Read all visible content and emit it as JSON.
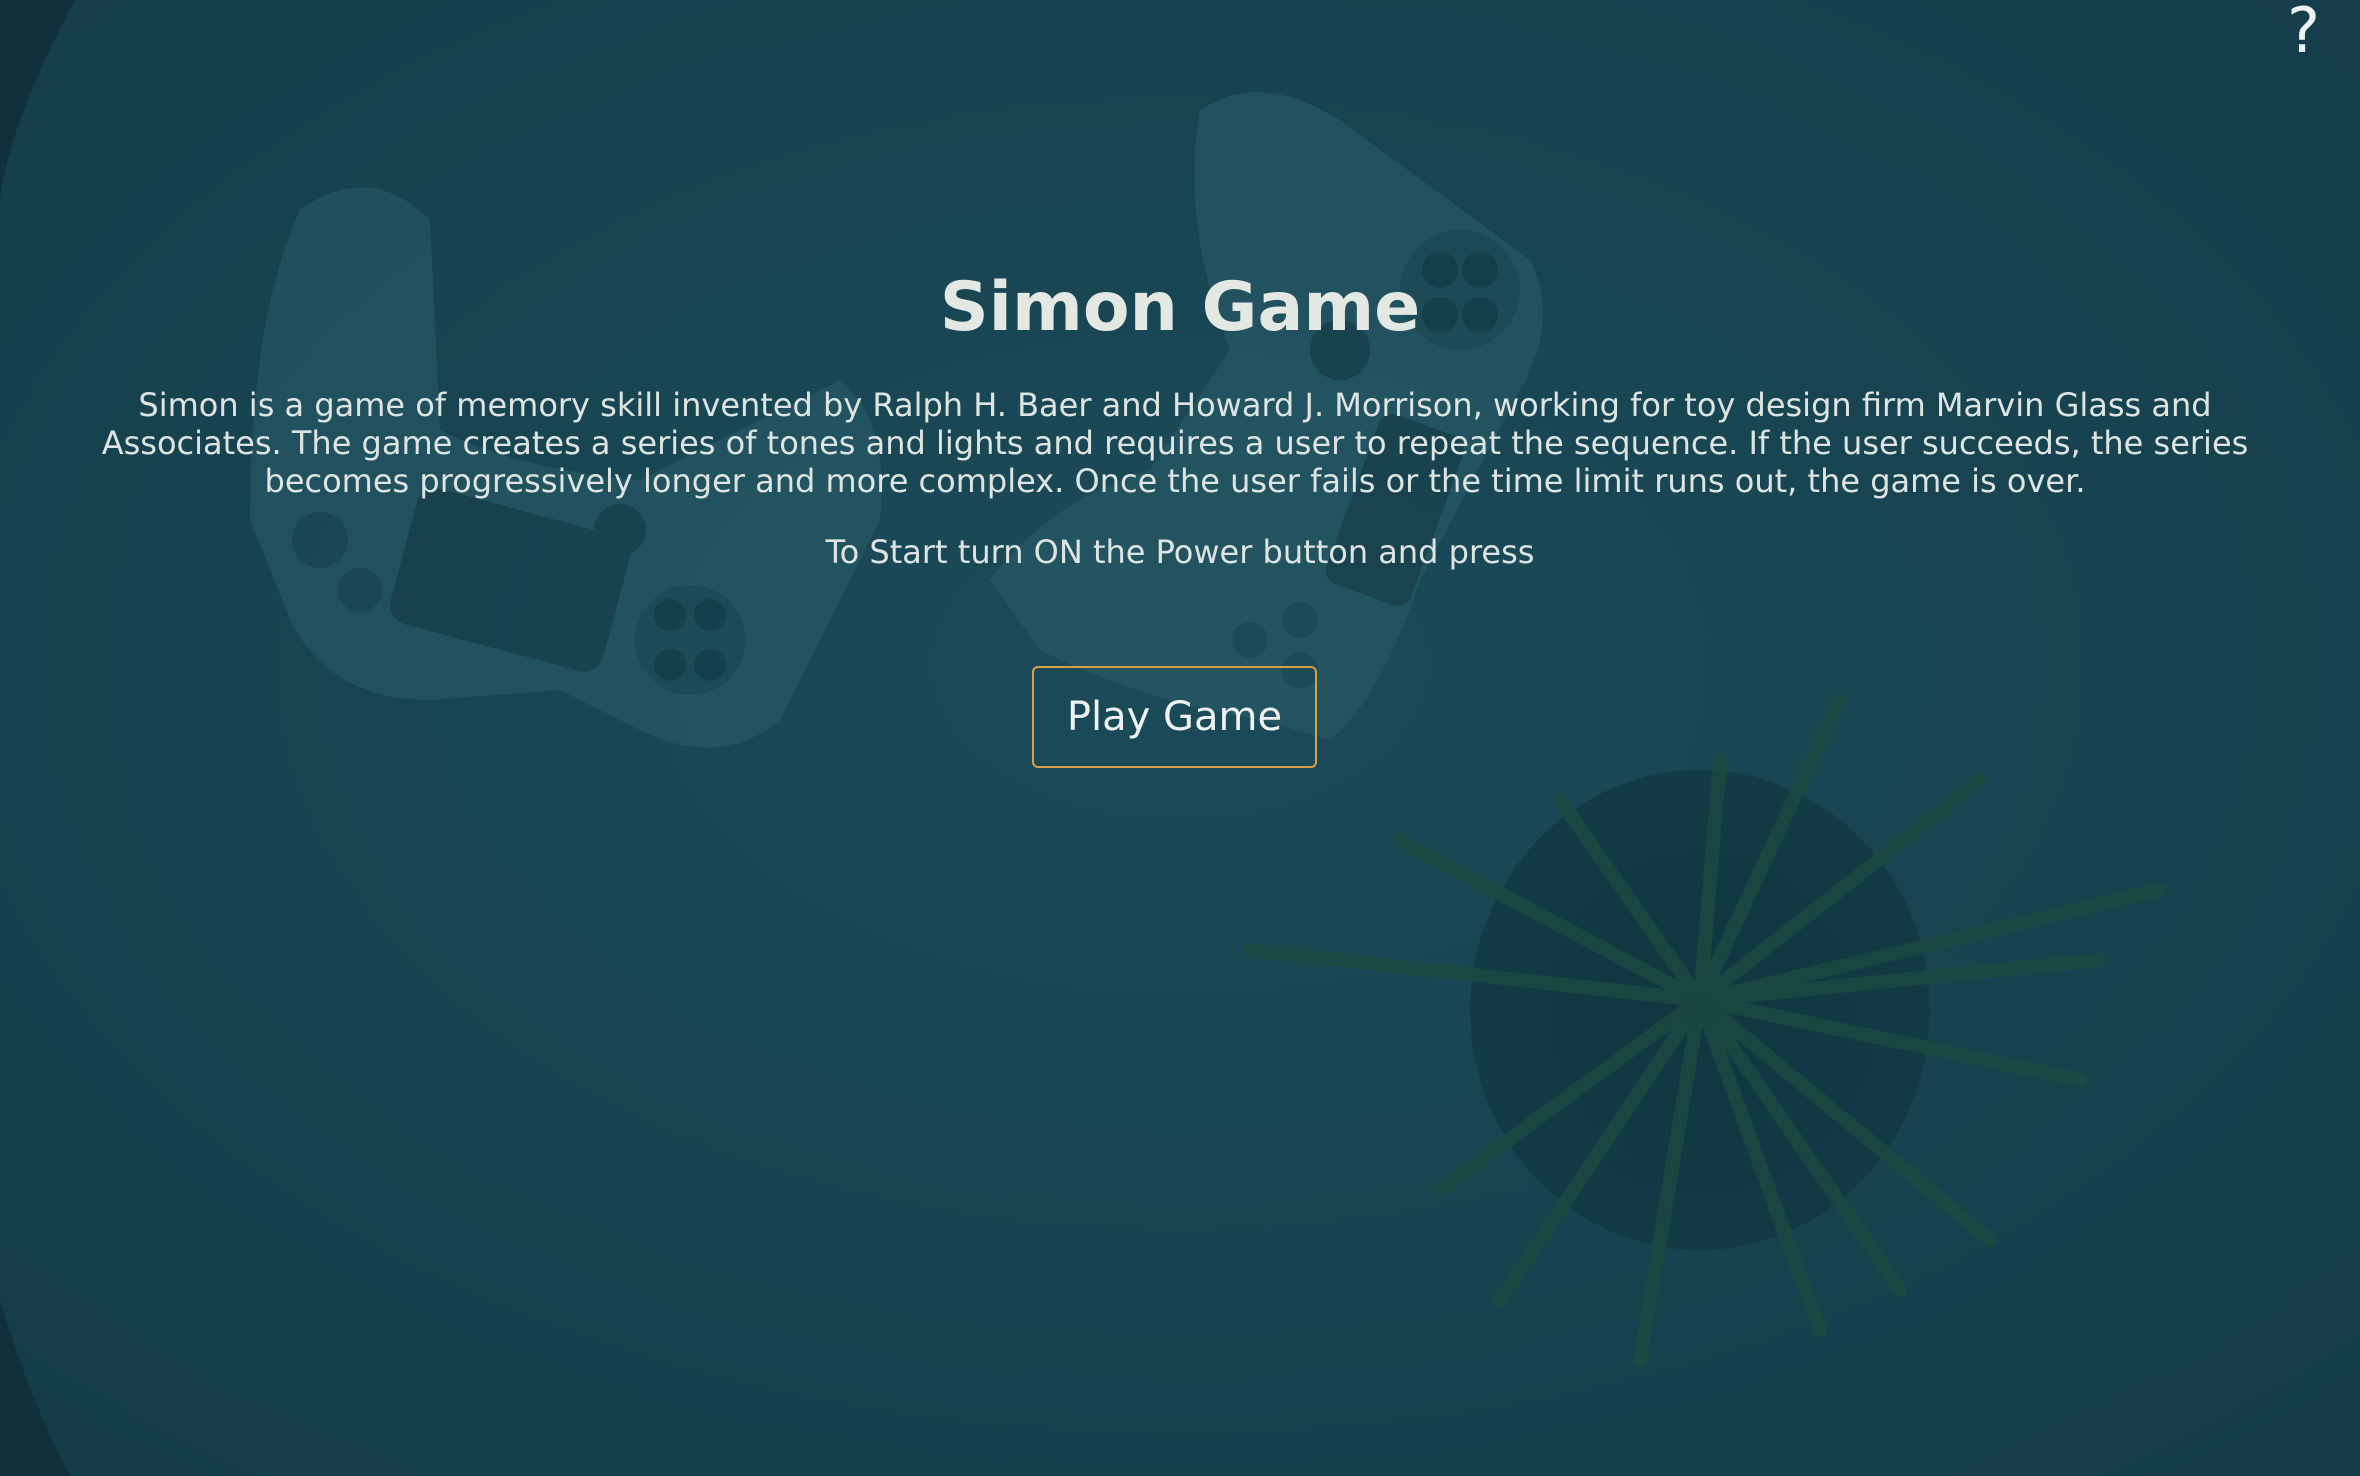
{
  "header": {
    "help_label": "?"
  },
  "main": {
    "title": "Simon Game",
    "description": "Simon is a game of memory skill invented by Ralph H. Baer and Howard J. Morrison, working for toy design firm Marvin Glass and Associates. The game creates a series of tones and lights and requires a user to repeat the sequence. If the user succeeds, the series becomes progressively longer and more complex. Once the user fails or the time limit runs out, the game is over.",
    "instruction": "To Start turn ON the Power button and press",
    "play_button_label": "Play Game"
  },
  "colors": {
    "background": "#194552",
    "button_border": "#d9a04a",
    "text": "#e6ebe8"
  }
}
